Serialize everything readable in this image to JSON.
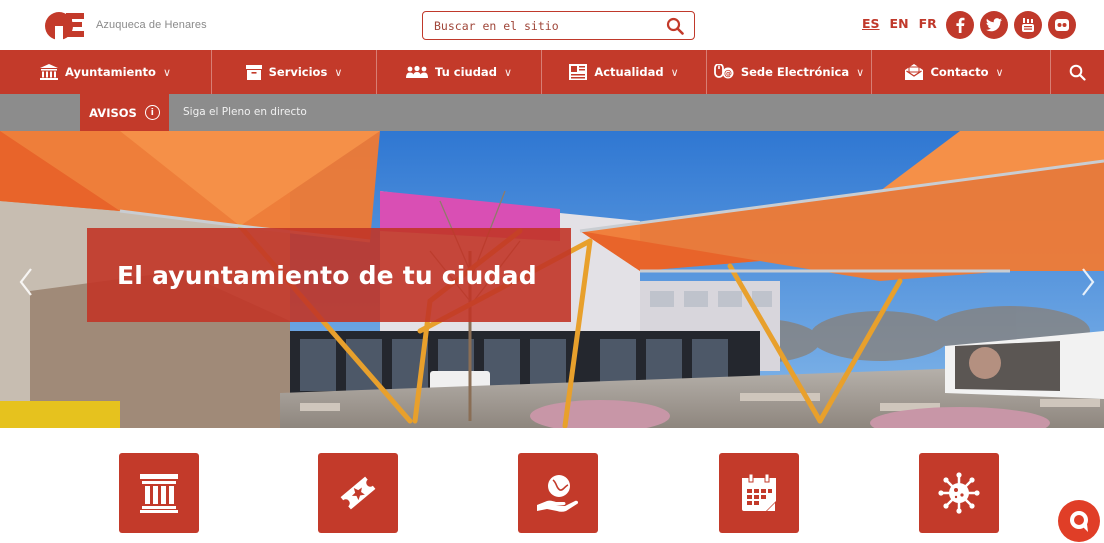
{
  "header": {
    "site_name": "Azuqueca de Henares",
    "search_placeholder": "Buscar en el sitio",
    "languages": [
      {
        "code": "ES",
        "active": true
      },
      {
        "code": "EN",
        "active": false
      },
      {
        "code": "FR",
        "active": false
      }
    ],
    "socials": [
      "facebook-icon",
      "twitter-icon",
      "youtube-icon",
      "flickr-icon"
    ]
  },
  "nav": {
    "items": [
      {
        "label": "Ayuntamiento",
        "icon": "columns-icon"
      },
      {
        "label": "Servicios",
        "icon": "archive-box-icon"
      },
      {
        "label": "Tu ciudad",
        "icon": "people-icon"
      },
      {
        "label": "Actualidad",
        "icon": "newspaper-icon"
      },
      {
        "label": "Sede Electrónica",
        "icon": "mouse-at-icon"
      },
      {
        "label": "Contacto",
        "icon": "envelope-icon"
      }
    ],
    "chevron": "∨"
  },
  "avisos": {
    "label": "AVISOS",
    "info_glyph": "i",
    "message": "Siga el Pleno en directo"
  },
  "hero": {
    "title": "El ayuntamiento de tu ciudad",
    "prev_icon": "chevron-left-icon",
    "next_icon": "chevron-right-icon"
  },
  "tiles": [
    {
      "icon": "columns-icon"
    },
    {
      "icon": "ticket-star-icon"
    },
    {
      "icon": "hand-globe-icon"
    },
    {
      "icon": "calendar-icon"
    },
    {
      "icon": "virus-icon"
    }
  ],
  "colors": {
    "brand_red": "#c33a2a",
    "avisos_gray": "#8c8c8c",
    "chat_orange": "#e03e27"
  }
}
